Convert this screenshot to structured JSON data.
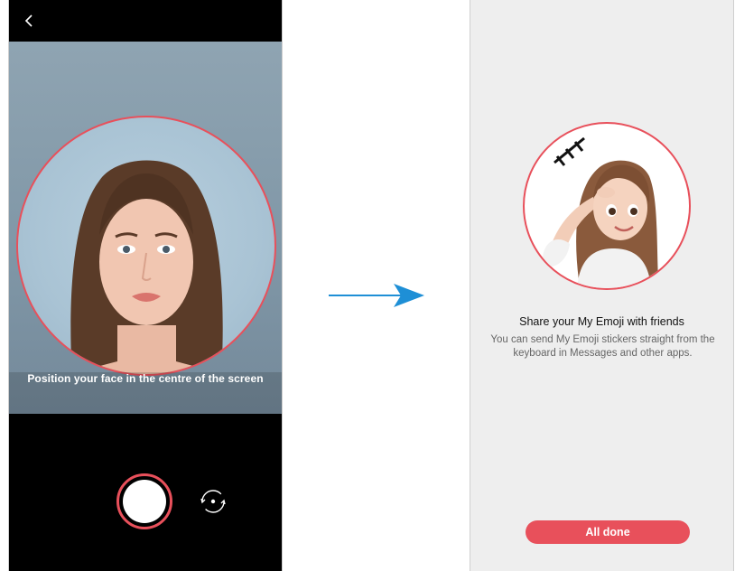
{
  "camera_screen": {
    "hint": "Position your face in the centre of the screen",
    "icons": {
      "back": "chevron-left-icon",
      "switch": "switch-camera-icon"
    }
  },
  "emoji_screen": {
    "title": "Share your My Emoji with friends",
    "description": "You can send My Emoji stickers straight from the keyboard in Messages and other apps.",
    "done_label": "All done"
  },
  "colors": {
    "accent": "#e8505b",
    "arrow": "#1e8fd6",
    "panel_bg": "#eeeeee"
  }
}
